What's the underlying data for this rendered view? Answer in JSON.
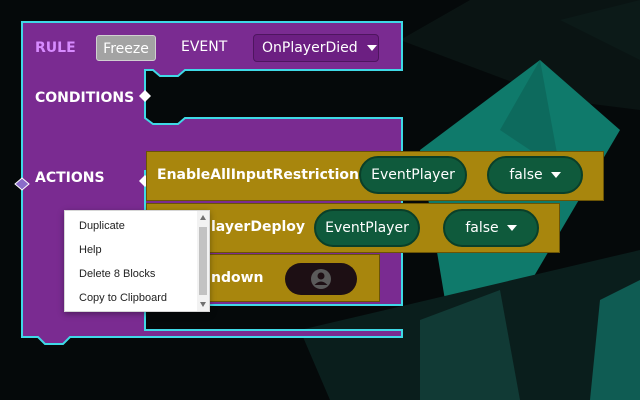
{
  "rule": {
    "rule_label": "RULE",
    "freeze_label": "Freeze",
    "event_label": "EVENT",
    "event_value": "OnPlayerDied",
    "conditions_label": "CONDITIONS",
    "actions_label": "ACTIONS"
  },
  "actions": [
    {
      "label": "EnableAllInputRestrictions",
      "player": "EventPlayer",
      "value": "false"
    },
    {
      "label_visible": "layerDeploy",
      "player": "EventPlayer",
      "value": "false"
    },
    {
      "label_visible": "ndown"
    }
  ],
  "context_menu": {
    "items": [
      "Duplicate",
      "Help",
      "Delete 8 Blocks",
      "Copy to Clipboard"
    ]
  },
  "colors": {
    "rule_block": "#7a2b91",
    "outline": "#3fd9e6",
    "action_block": "#a8860d",
    "player_pill": "#0f5a3c",
    "rule_label": "#d78bff",
    "background_accent": "#0f7a6b"
  },
  "icons": {
    "player_icon": "person-icon",
    "dropdown_icon": "chevron-down-icon"
  }
}
